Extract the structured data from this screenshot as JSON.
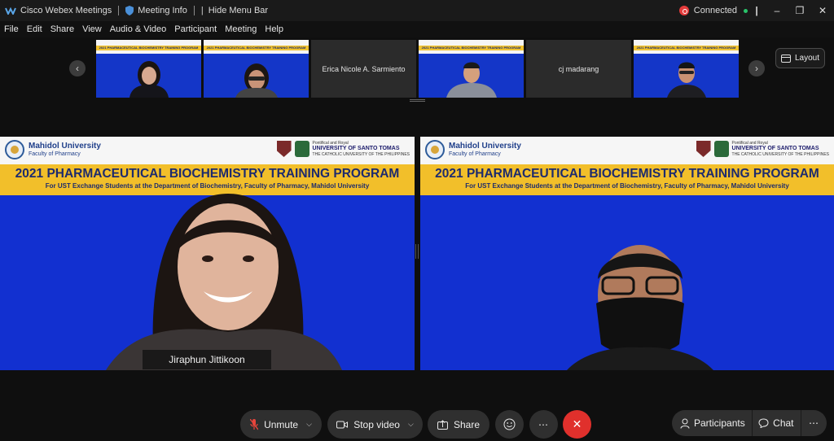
{
  "titlebar": {
    "app_name": "Cisco Webex Meetings",
    "meeting_info": "Meeting Info",
    "hide_menu": "Hide Menu Bar",
    "status": "Connected"
  },
  "menu": [
    "File",
    "Edit",
    "Share",
    "View",
    "Audio & Video",
    "Participant",
    "Meeting",
    "Help"
  ],
  "filmstrip": {
    "thumbnails": [
      {
        "type": "video",
        "banner_title": "2021 PHARMACEUTICAL BIOCHEMISTRY TRAINING PROGRAM"
      },
      {
        "type": "video",
        "banner_title": "2021 PHARMACEUTICAL BIOCHEMISTRY TRAINING PROGRAM"
      },
      {
        "type": "name",
        "name": "Erica Nicole A. Sarmiento"
      },
      {
        "type": "video",
        "banner_title": "2021 PHARMACEUTICAL BIOCHEMISTRY TRAINING PROGRAM"
      },
      {
        "type": "name",
        "name": "cj madarang"
      },
      {
        "type": "video",
        "banner_title": "2021 PHARMACEUTICAL BIOCHEMISTRY TRAINING PROGRAM"
      }
    ],
    "layout_label": "Layout"
  },
  "main": {
    "banner": {
      "university": "Mahidol University",
      "faculty": "Faculty of Pharmacy",
      "partner_small": "Pontifical and Royal",
      "partner": "UNIVERSITY OF SANTO TOMAS",
      "partner_tag": "THE CATHOLIC UNIVERSITY OF THE PHILIPPINES",
      "program_title": "2021 PHARMACEUTICAL BIOCHEMISTRY TRAINING PROGRAM",
      "program_sub": "For UST Exchange Students at the Department of Biochemistry, Faculty of Pharmacy, Mahidol University"
    },
    "left_participant": "Jiraphun Jittikoon"
  },
  "controls": {
    "unmute": "Unmute",
    "stop_video": "Stop video",
    "share": "Share",
    "participants": "Participants",
    "chat": "Chat"
  },
  "colors": {
    "end_button": "#e0302c",
    "video_bg": "#1230d0",
    "banner_yellow": "#f2bf2a",
    "connected_green": "#29c46a"
  }
}
